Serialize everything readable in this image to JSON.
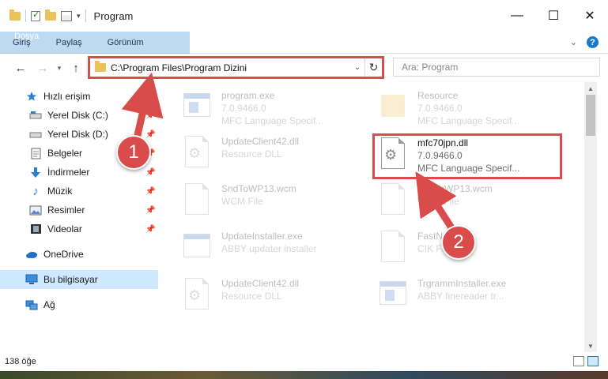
{
  "window": {
    "title": "Program",
    "controls": {
      "minimize": "—",
      "maximize": "☐",
      "close": "✕"
    }
  },
  "ribbon": {
    "tabs": [
      "Dosya",
      "Giriş",
      "Paylaş",
      "Görünüm"
    ],
    "help": "?"
  },
  "nav": {
    "address": "C:\\Program Files\\Program Dizini",
    "search_placeholder": "Ara: Program"
  },
  "sidebar": {
    "items": [
      {
        "label": "Hızlı erişim",
        "icon": "star-icon",
        "pinned": false
      },
      {
        "label": "Yerel Disk (C:)",
        "icon": "drive-icon",
        "pinned": true
      },
      {
        "label": "Yerel Disk (D:)",
        "icon": "drive-icon",
        "pinned": true
      },
      {
        "label": "Belgeler",
        "icon": "documents-icon",
        "pinned": true
      },
      {
        "label": "İndirmeler",
        "icon": "download-icon",
        "pinned": true
      },
      {
        "label": "Müzik",
        "icon": "music-icon",
        "pinned": true
      },
      {
        "label": "Resimler",
        "icon": "pictures-icon",
        "pinned": true
      },
      {
        "label": "Videolar",
        "icon": "video-icon",
        "pinned": true
      },
      {
        "label": "OneDrive",
        "icon": "cloud-icon",
        "pinned": false
      },
      {
        "label": "Bu bilgisayar",
        "icon": "computer-icon",
        "pinned": false
      },
      {
        "label": "Ağ",
        "icon": "network-icon",
        "pinned": false
      }
    ],
    "pin_glyph": "📌"
  },
  "files": [
    {
      "name": "program.exe",
      "line2": "7.0.9466.0",
      "line3": "MFC Language Specif...",
      "icon": "exe-icon"
    },
    {
      "name": "Resource",
      "line2": "7.0.9466.0",
      "line3": "MFC Language Specif...",
      "icon": "folder-icon"
    },
    {
      "name": "UpdateClient42.dll",
      "line2": "Resource DLL",
      "line3": "",
      "icon": "dll-icon"
    },
    {
      "name": "mfc70jpn.dll",
      "line2": "7.0.9466.0",
      "line3": "MFC Language Specif...",
      "icon": "dll-icon"
    },
    {
      "name": "SndToWP13.wcm",
      "line2": "WCM File",
      "line3": "",
      "icon": "file-icon"
    },
    {
      "name": "SndToWP13.wcm",
      "line2": "WCM File",
      "line3": "",
      "icon": "file-icon"
    },
    {
      "name": "UpdateInstaller.exe",
      "line2": "ABBY updater installer",
      "line3": "",
      "icon": "exe-icon"
    },
    {
      "name": "FastN...",
      "line2": "CIK File",
      "line3": "",
      "icon": "file-icon"
    },
    {
      "name": "UpdateClient42.dll",
      "line2": "Resource DLL",
      "line3": "",
      "icon": "dll-icon"
    },
    {
      "name": "TrgrammInstaller.exe",
      "line2": "ABBY finereader tr...",
      "line3": "",
      "icon": "exe-icon"
    }
  ],
  "status": {
    "count": "138 öğe"
  },
  "annotations": {
    "step1": "1",
    "step2": "2"
  },
  "colors": {
    "accent": "#1979ca",
    "highlight": "#d94c4c",
    "selected": "#cde8ff"
  }
}
